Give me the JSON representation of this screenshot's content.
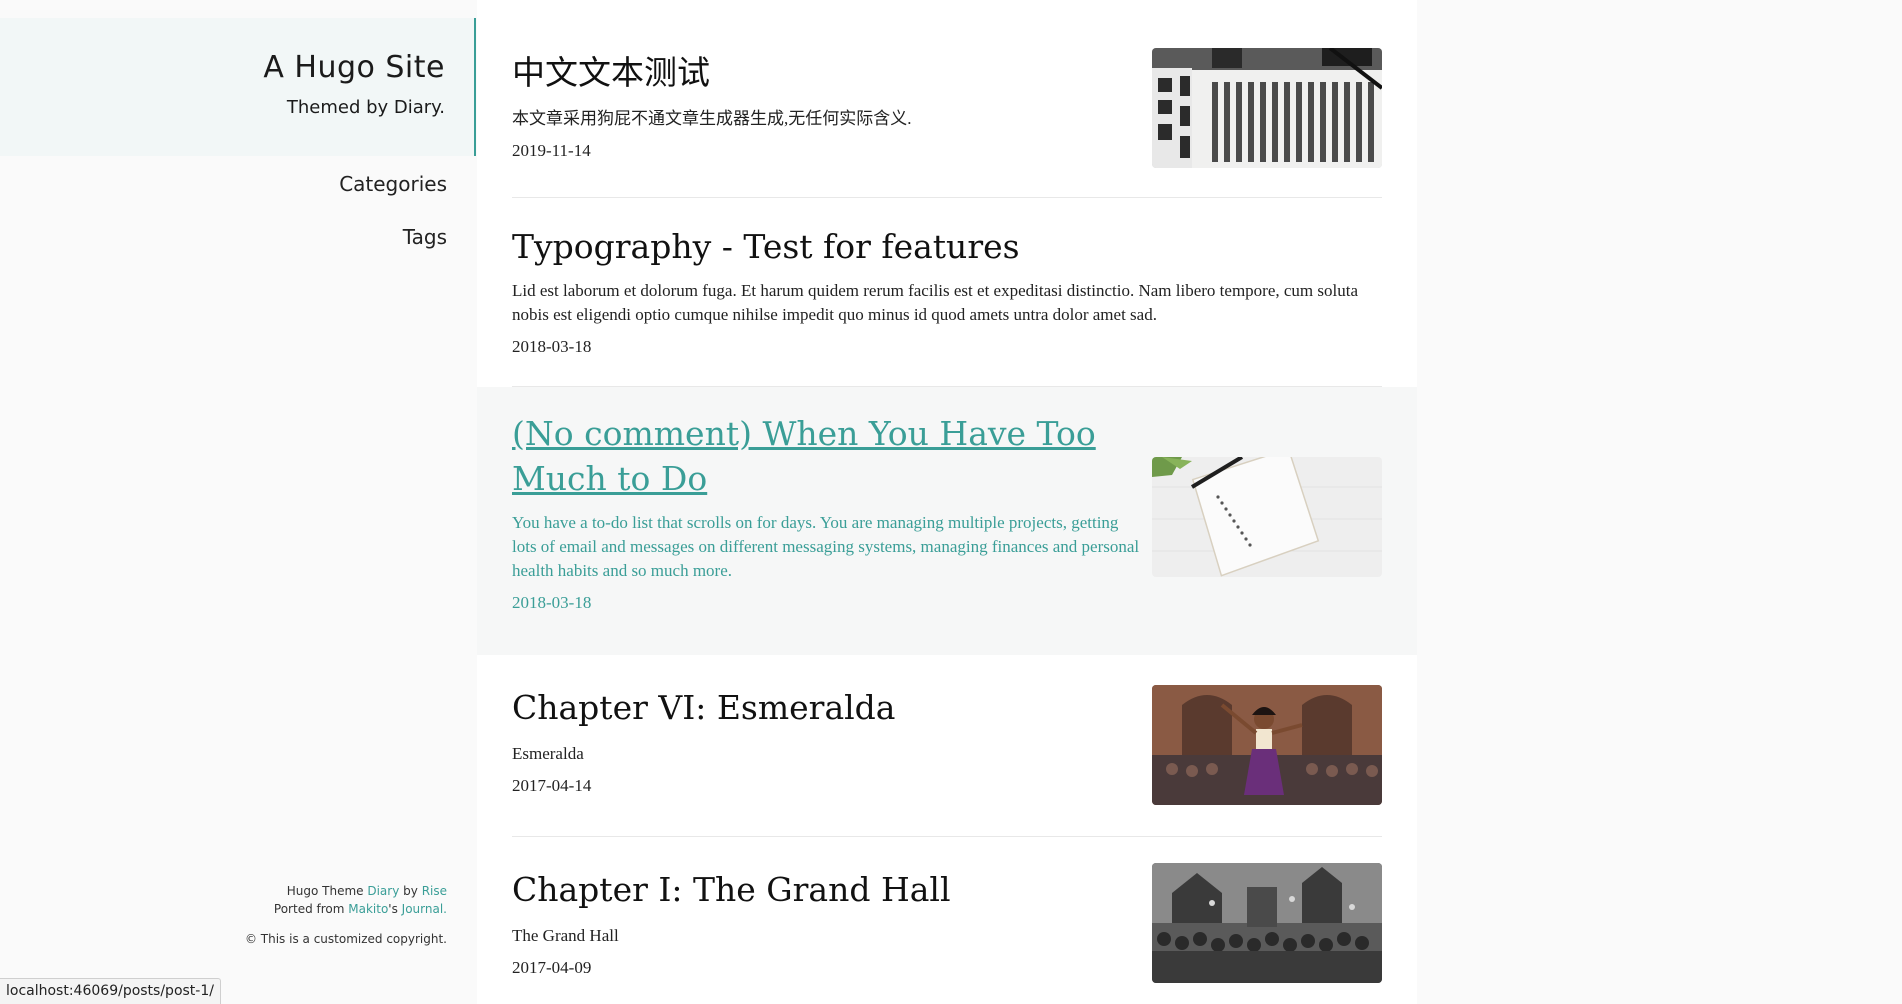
{
  "site": {
    "title": "A Hugo Site",
    "subtitle": "Themed by Diary."
  },
  "nav": {
    "items": [
      {
        "label": "Categories"
      },
      {
        "label": "Tags"
      }
    ]
  },
  "footer": {
    "theme_prefix": "Hugo Theme ",
    "theme_name": "Diary",
    "theme_by": " by ",
    "theme_author": "Rise",
    "ported_prefix": "Ported from ",
    "ported_author": "Makito",
    "ported_suffix": "'s ",
    "ported_theme": "Journal.",
    "copyright": "© This is a customized copyright."
  },
  "posts": [
    {
      "title": "中文文本测试",
      "excerpt": "本文章采用狗屁不通文章生成器生成,无任何实际含义.",
      "date": "2019-11-14",
      "thumbnail": "chinese-calligraphy-image"
    },
    {
      "title": "Typography - Test for features",
      "excerpt": "Lid est laborum et dolorum fuga. Et harum quidem rerum facilis est et expeditasi distinctio. Nam libero tempore, cum soluta nobis est eligendi optio cumque nihilse impedit quo minus id quod amets untra dolor amet sad.",
      "date": "2018-03-18"
    },
    {
      "title": "(No comment) When You Have Too Much to Do",
      "excerpt": "You have a to-do list that scrolls on for days. You are managing multiple projects, getting lots of email and messages on different messaging systems, managing finances and personal health habits and so much more.",
      "date": "2018-03-18",
      "thumbnail": "notebook-image"
    },
    {
      "title": "Chapter VI: Esmeralda",
      "excerpt": "Esmeralda",
      "date": "2017-04-14",
      "thumbnail": "esmeralda-image"
    },
    {
      "title": "Chapter I: The Grand Hall",
      "excerpt": "The Grand Hall",
      "date": "2017-04-09",
      "thumbnail": "grand-hall-image"
    }
  ],
  "colors": {
    "accent": "#3a9e97",
    "sidebar_header_bg": "#f2f7f7",
    "highlight_bg": "#f6f7f7"
  },
  "statusbar": {
    "url": "localhost:46069/posts/post-1/"
  }
}
